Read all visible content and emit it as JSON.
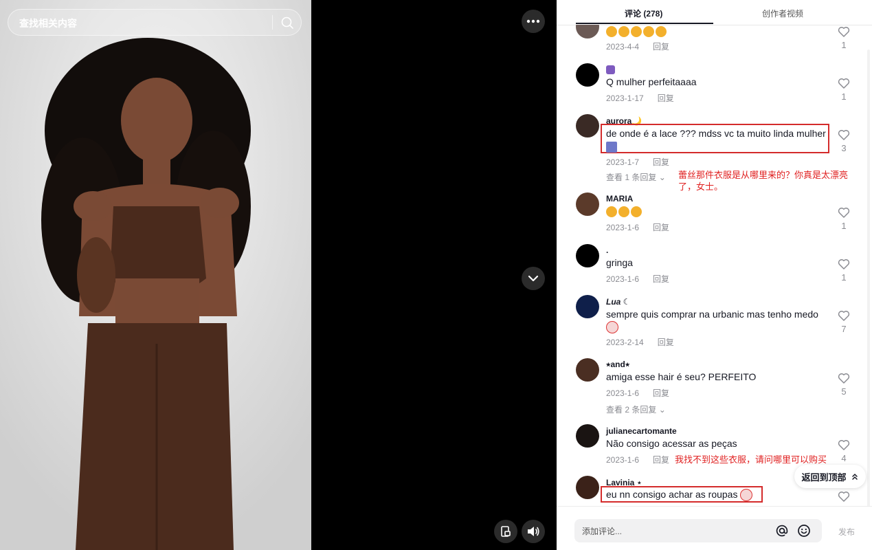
{
  "search": {
    "placeholder": "查找相关内容"
  },
  "tabs": [
    {
      "label": "评论 (278)"
    },
    {
      "label": "创作者视频"
    }
  ],
  "comments": [
    {
      "username": "",
      "text": "",
      "emojis": 5,
      "date": "2023-4-4",
      "reply": "回复",
      "likes": "1"
    },
    {
      "username": "",
      "text": "Q mulher perfeitaaaa",
      "date": "2023-1-17",
      "reply": "回复",
      "likes": "1"
    },
    {
      "username": "aurora🌙",
      "text": "de onde é a lace ??? mdss vc ta muito linda mulher",
      "date": "2023-1-7",
      "reply": "回复",
      "likes": "3",
      "view_replies": "查看 1 条回复"
    },
    {
      "username": "MARIA",
      "text": "",
      "emojis": 3,
      "date": "2023-1-6",
      "reply": "回复",
      "likes": "1"
    },
    {
      "username": ".",
      "text": "gringa",
      "date": "2023-1-6",
      "reply": "回复",
      "likes": "1"
    },
    {
      "username": "Lua ☾",
      "text": "sempre quis comprar na urbanic mas tenho medo",
      "date": "2023-2-14",
      "reply": "回复",
      "likes": "7"
    },
    {
      "username": "⭒and⭒",
      "text": "amiga esse hair é seu? PERFEITO",
      "date": "2023-1-6",
      "reply": "回复",
      "likes": "5",
      "view_replies": "查看 2 条回复"
    },
    {
      "username": "julianecartomante",
      "text": "Não consigo acessar as peças",
      "date": "2023-1-6",
      "reply": "回复",
      "likes": "4"
    },
    {
      "username": "Lavinia ⋆",
      "text": "eu nn consigo achar as roupas",
      "date": "",
      "reply": "",
      "likes": ""
    }
  ],
  "annotations": {
    "aurora": "蕾丝那件衣服是从哪里来的？你真是太漂亮了，女士。",
    "juliane": "我找不到这些衣服，请问哪里可以购买"
  },
  "back_to_top": "返回到顶部",
  "comment_input": {
    "placeholder": "添加评论..."
  },
  "post_label": "发布",
  "colors": {
    "highlight": "#d42b2b",
    "annotation": "#e02020",
    "tab_active": "#161823"
  },
  "icons": [
    "search-icon",
    "more-icon",
    "chevron-down-icon",
    "pip-icon",
    "volume-icon",
    "heart-icon",
    "at-icon",
    "emoji-icon",
    "chevron-up-icon"
  ]
}
